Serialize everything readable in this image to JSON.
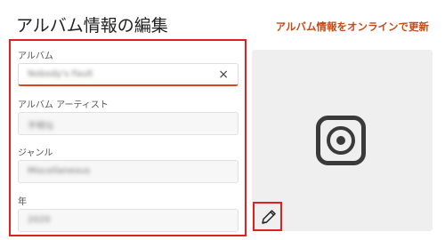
{
  "header": {
    "title": "アルバム情報の編集",
    "update_online_link": "アルバム情報をオンラインで更新"
  },
  "form": {
    "album": {
      "label": "アルバム",
      "value": "Nobody's Fault"
    },
    "album_artist": {
      "label": "アルバム アーティスト",
      "value": "不明な"
    },
    "genre": {
      "label": "ジャンル",
      "value": "Miscellaneous"
    },
    "year": {
      "label": "年",
      "value": "2020"
    },
    "clear_glyph": "×"
  },
  "album_art": {
    "placeholder_icon": "album-art-placeholder-icon",
    "edit_icon": "pencil-icon"
  },
  "colors": {
    "accent": "#d6471b",
    "highlight_frame": "#e02020",
    "link": "#c94a16"
  }
}
